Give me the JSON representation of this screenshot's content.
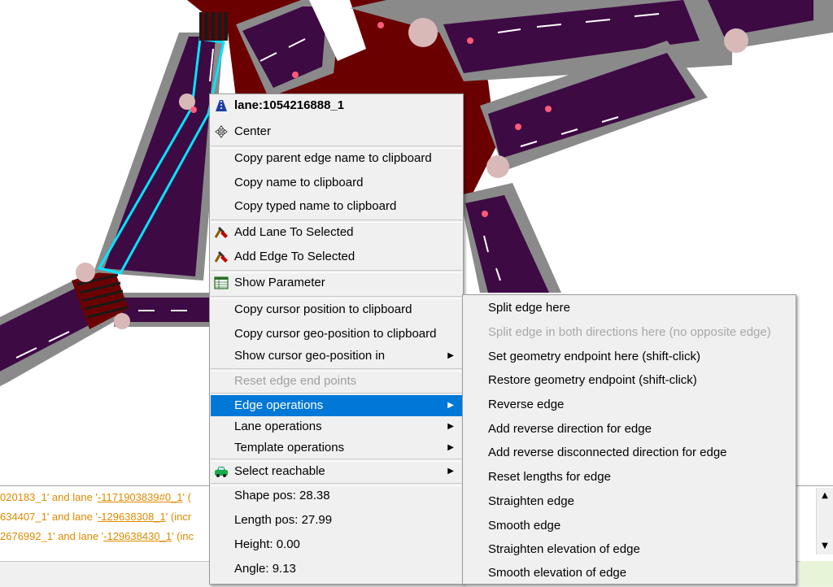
{
  "log": {
    "lines": [
      {
        "prefix": "020183_1' and lane '",
        "link": "-1171903839#0_1",
        "suffix": "' ("
      },
      {
        "prefix": "634407_1' and lane '",
        "link": "-129638308_1",
        "suffix": "' (incr"
      },
      {
        "prefix": "2676992_1' and lane '",
        "link": "-129638430_1",
        "suffix": "' (inc"
      }
    ]
  },
  "context_menu": {
    "title": "lane:1054216888_1",
    "center": "Center",
    "copy_parent_edge": "Copy parent edge name to clipboard",
    "copy_name": "Copy name to clipboard",
    "copy_typed_name": "Copy typed name to clipboard",
    "add_lane_selected": "Add Lane To Selected",
    "add_edge_selected": "Add Edge To Selected",
    "show_parameter": "Show Parameter",
    "copy_cursor_pos": "Copy cursor position to clipboard",
    "copy_cursor_geo": "Copy cursor geo-position to clipboard",
    "show_cursor_geo": "Show cursor geo-position in",
    "reset_edge_end": "Reset edge end points",
    "edge_operations": "Edge operations",
    "lane_operations": "Lane operations",
    "template_operations": "Template operations",
    "select_reachable": "Select reachable",
    "shape_pos": "Shape pos: 28.38",
    "length_pos": "Length pos: 27.99",
    "height": "Height: 0.00",
    "angle": "Angle: 9.13"
  },
  "submenu": {
    "split_edge": "Split edge here",
    "split_both": "Split edge in both directions here (no opposite edge)",
    "set_geometry": "Set geometry endpoint here (shift-click)",
    "restore_geometry": "Restore geometry endpoint (shift-click)",
    "reverse_edge": "Reverse edge",
    "add_reverse": "Add reverse direction for edge",
    "add_reverse_disconnected": "Add reverse disconnected direction for edge",
    "reset_lengths": "Reset lengths for edge",
    "straighten": "Straighten edge",
    "smooth": "Smooth edge",
    "straighten_elevation": "Straighten elevation of edge",
    "smooth_elevation": "Smooth elevation of edge"
  },
  "colors": {
    "junction": "#6b0000",
    "lane": "#3d0a44",
    "sidewalk": "#8a8a8a",
    "selection": "#00e5ff",
    "menu_highlight": "#0078d7",
    "log_text": "#e08a00"
  },
  "icons": {
    "lane": "lane-icon",
    "center": "move-arrows-icon",
    "add": "add-to-selection-icon",
    "parameter": "parameter-table-icon",
    "reachable": "car-icon"
  }
}
